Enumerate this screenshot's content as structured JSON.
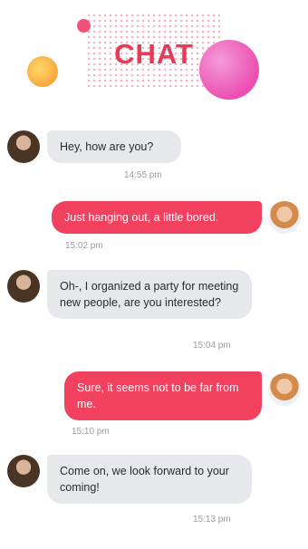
{
  "header": {
    "title": "CHAT"
  },
  "messages": [
    {
      "text": "Hey, how are you?",
      "time": "14:55 pm",
      "side": "in"
    },
    {
      "text": "Just hanging out, a little bored.",
      "time": "15:02 pm",
      "side": "out"
    },
    {
      "text": "Oh-, I organized a party for meeting new people, are you interested?",
      "time": "15:04 pm",
      "side": "in"
    },
    {
      "text": "Sure, it seems not to be far from me.",
      "time": "15:10 pm",
      "side": "out"
    },
    {
      "text": "Come on, we look forward to your coming!",
      "time": "15:13 pm",
      "side": "in"
    }
  ],
  "colors": {
    "accent": "#e83a57",
    "outgoing_bubble": "#f1415f",
    "incoming_bubble": "#e7e8ec"
  }
}
